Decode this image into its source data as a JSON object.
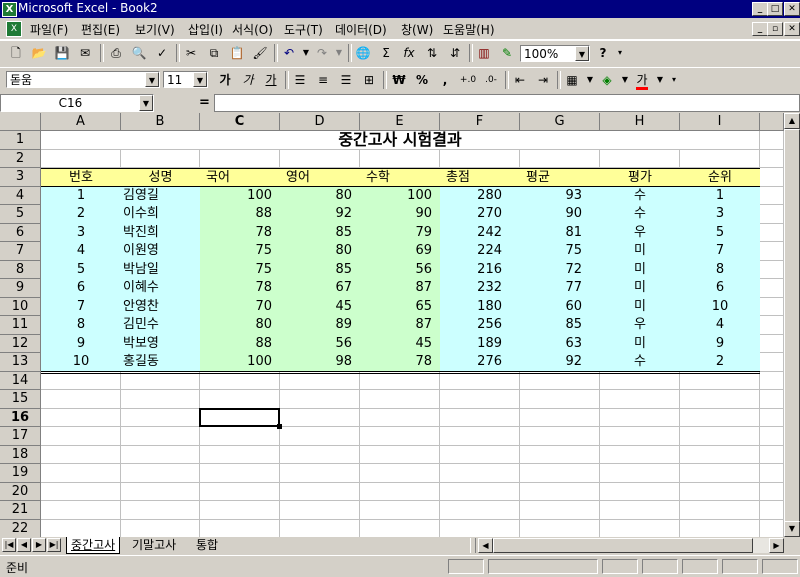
{
  "window": {
    "title": "Microsoft Excel - Book2"
  },
  "menu": [
    "파일(F)",
    "편집(E)",
    "보기(V)",
    "삽입(I)",
    "서식(O)",
    "도구(T)",
    "데이터(D)",
    "창(W)",
    "도움말(H)"
  ],
  "toolbar": {
    "zoom": "100%",
    "font": "돋움",
    "size": "11",
    "bold": "가",
    "italic": "가",
    "underline": "가",
    "comma": ",",
    "font_color_glyph": "가"
  },
  "namebox": "C16",
  "formula_eq": "=",
  "columns": [
    "A",
    "B",
    "C",
    "D",
    "E",
    "F",
    "G",
    "H",
    "I"
  ],
  "rows": [
    "1",
    "2",
    "3",
    "4",
    "5",
    "6",
    "7",
    "8",
    "9",
    "10",
    "11",
    "12",
    "13",
    "14",
    "15",
    "16",
    "17",
    "18",
    "19",
    "20",
    "21",
    "22"
  ],
  "sheet": {
    "title": "중간고사 시험결과",
    "headers": [
      "번호",
      "성명",
      "국어",
      "영어",
      "수학",
      "총점",
      "평균",
      "평가",
      "순위"
    ],
    "data": [
      [
        "1",
        "김영길",
        "100",
        "80",
        "100",
        "280",
        "93",
        "수",
        "1"
      ],
      [
        "2",
        "이수희",
        "88",
        "92",
        "90",
        "270",
        "90",
        "수",
        "3"
      ],
      [
        "3",
        "박진희",
        "78",
        "85",
        "79",
        "242",
        "81",
        "우",
        "5"
      ],
      [
        "4",
        "이원영",
        "75",
        "80",
        "69",
        "224",
        "75",
        "미",
        "7"
      ],
      [
        "5",
        "박남일",
        "75",
        "85",
        "56",
        "216",
        "72",
        "미",
        "8"
      ],
      [
        "6",
        "이혜수",
        "78",
        "67",
        "87",
        "232",
        "77",
        "미",
        "6"
      ],
      [
        "7",
        "안영찬",
        "70",
        "45",
        "65",
        "180",
        "60",
        "미",
        "10"
      ],
      [
        "8",
        "김민수",
        "80",
        "89",
        "87",
        "256",
        "85",
        "우",
        "4"
      ],
      [
        "9",
        "박보영",
        "88",
        "56",
        "45",
        "189",
        "63",
        "미",
        "9"
      ],
      [
        "10",
        "홍길동",
        "100",
        "98",
        "78",
        "276",
        "92",
        "수",
        "2"
      ]
    ]
  },
  "tabs": [
    "중간고사",
    "기말고사",
    "통합"
  ],
  "status": "준비",
  "colors": {
    "header_fill": "#ffff99",
    "data_fill": "#ccffff",
    "score_fill": "#ccffcc",
    "title_bar": "#000080"
  }
}
